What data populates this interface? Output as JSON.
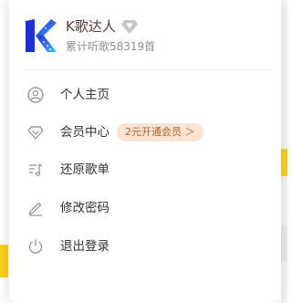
{
  "profile": {
    "username": "K歌达人",
    "listen_stats": "累计听歌58319首"
  },
  "menu": {
    "items": [
      {
        "label": "个人主页",
        "icon": "user-icon"
      },
      {
        "label": "会员中心",
        "icon": "diamond-icon",
        "promo": "2元开通会员 ＞"
      },
      {
        "label": "还原歌单",
        "icon": "playlist-restore-icon"
      },
      {
        "label": "修改密码",
        "icon": "pencil-icon"
      },
      {
        "label": "退出登录",
        "icon": "power-icon"
      }
    ]
  },
  "colors": {
    "accent": "#ffd21e",
    "promo_background": "#fde3d0",
    "promo_text": "#a8642f",
    "username_text": "#5a3b3b"
  }
}
